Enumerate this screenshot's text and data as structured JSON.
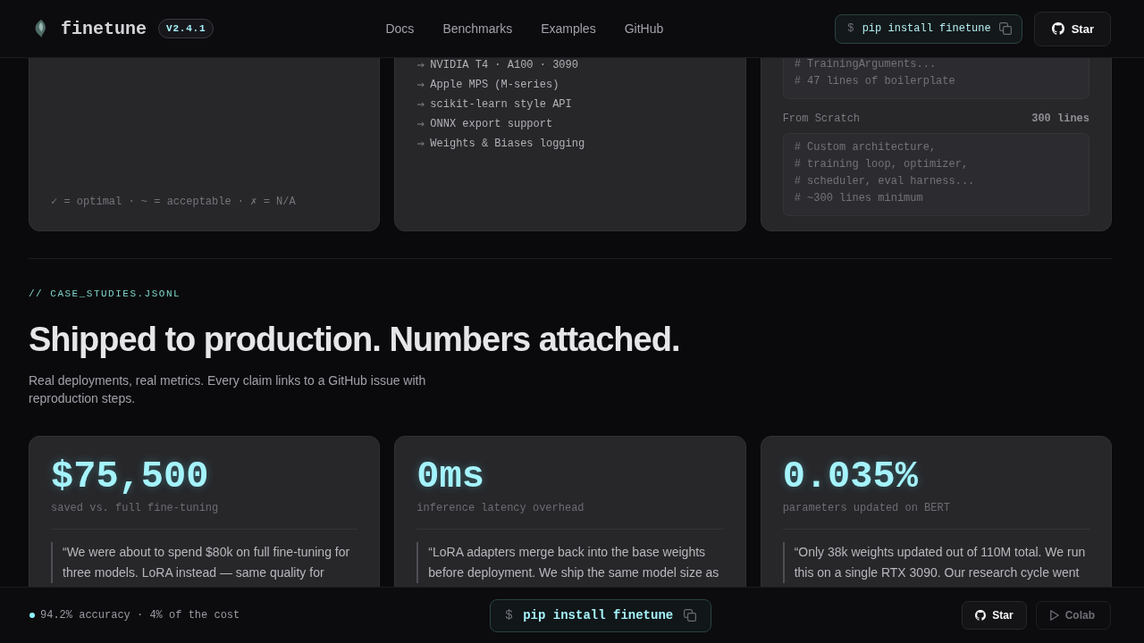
{
  "header": {
    "brand": "finetune",
    "version": "V2.4.1",
    "nav": [
      "Docs",
      "Benchmarks",
      "Examples",
      "GitHub"
    ],
    "install": {
      "prompt": "$",
      "command": "pip install finetune"
    },
    "star_button": {
      "label": "Star"
    }
  },
  "feature_cards": [
    {
      "kind": "legend",
      "legend": "✓ = optimal · ~ = acceptable · ✗ = N/A"
    },
    {
      "kind": "list",
      "items": [
        "NVIDIA T4 · A100 · 3090",
        "Apple MPS (M-series)",
        "scikit-learn style API",
        "ONNX export support",
        "Weights & Biases logging"
      ]
    },
    {
      "kind": "comparison",
      "sections": [
        {
          "code": [
            "# TrainingArguments...",
            "# 47 lines of boilerplate"
          ]
        },
        {
          "label": "From Scratch",
          "count": "300 lines",
          "code": [
            "# Custom architecture,",
            "# training loop, optimizer,",
            "# scheduler, eval harness...",
            "# ~300 lines minimum"
          ]
        }
      ]
    }
  ],
  "case_studies": {
    "eyebrow": "// CASE_STUDIES.JSONL",
    "title": "Shipped to production. Numbers attached.",
    "subtitle": "Real deployments, real metrics. Every claim links to a GitHub issue with reproduction steps.",
    "cards": [
      {
        "stat": "$75,500",
        "caption": "saved vs. full fine-tuning",
        "quote": "“We were about to spend $80k on full fine-tuning for three models. LoRA instead — same quality for"
      },
      {
        "stat": "0ms",
        "caption": "inference latency overhead",
        "quote": "“LoRA adapters merge back into the base weights before deployment. We ship the same model size as"
      },
      {
        "stat": "0.035%",
        "caption": "parameters updated on BERT",
        "quote": "“Only 38k weights updated out of 110M total. We run this on a single RTX 3090. Our research cycle went"
      }
    ]
  },
  "bottom_bar": {
    "status": "94.2% accuracy · 4% of the cost",
    "install": {
      "prompt": "$",
      "command": "pip install finetune"
    },
    "buttons": [
      {
        "kind": "github",
        "label": "Star"
      },
      {
        "kind": "play",
        "label": "Colab"
      }
    ]
  }
}
